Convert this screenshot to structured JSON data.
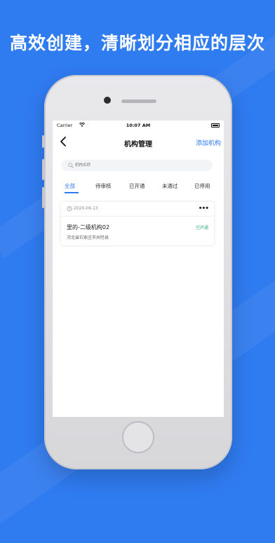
{
  "headline": "高效创建，清晰划分相应的层次",
  "status_bar": {
    "carrier": "Carrier",
    "time": "10:07 AM"
  },
  "nav": {
    "title": "机构管理",
    "action": "添加机构"
  },
  "search": {
    "placeholder": "机构名称"
  },
  "tabs": [
    {
      "label": "全部",
      "active": true
    },
    {
      "label": "待审核"
    },
    {
      "label": "已开通"
    },
    {
      "label": "未通过"
    },
    {
      "label": "已停用"
    }
  ],
  "card": {
    "date": "2020-06-13",
    "name": "里的-二级机构02",
    "status": "已开通",
    "address": "河北省石家庄市井陉县"
  },
  "colors": {
    "accent": "#2f7bf0",
    "status_green": "#36b37e",
    "background": "#2f7bf0"
  },
  "icons": [
    "back-chevron-icon",
    "search-icon",
    "clock-icon",
    "more-icon",
    "wifi-icon",
    "battery-icon"
  ]
}
